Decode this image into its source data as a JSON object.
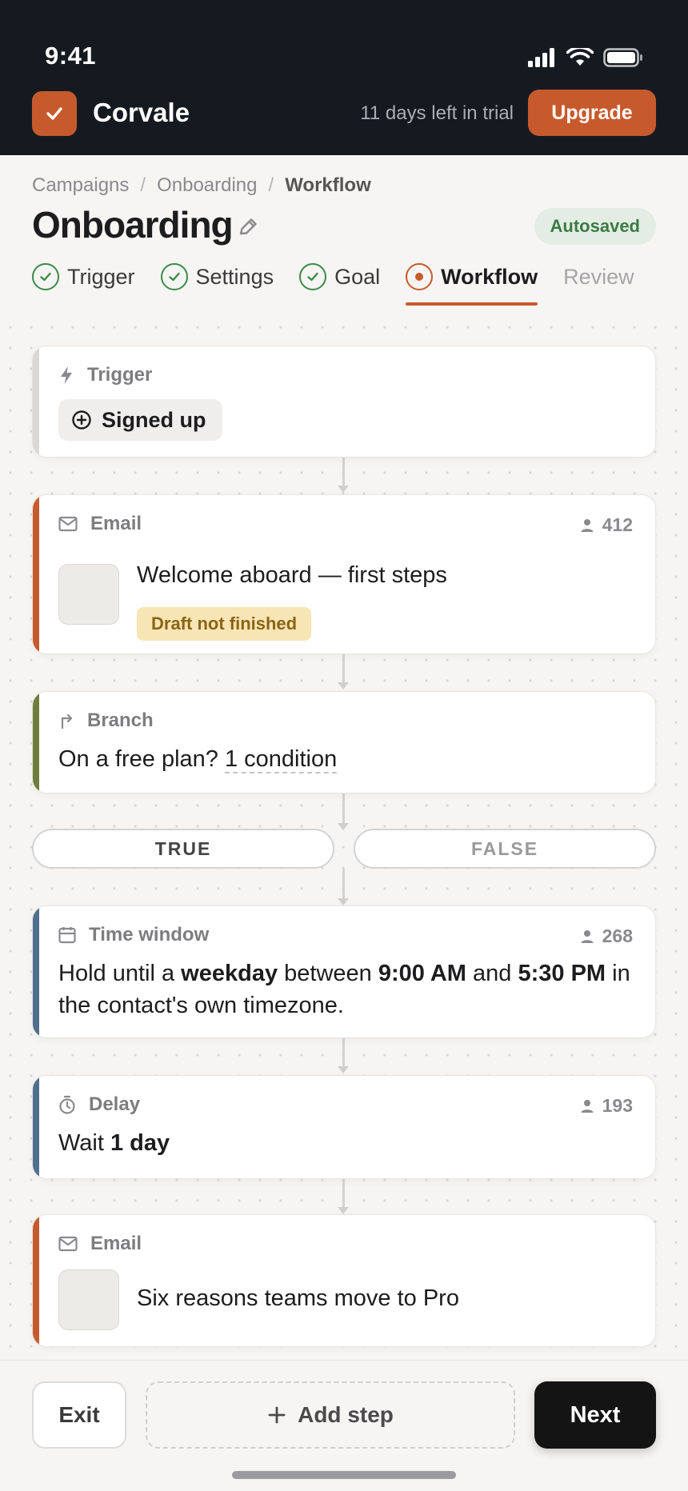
{
  "status_bar": {
    "time": "9:41"
  },
  "app": {
    "name": "Corvale",
    "trial_text": "11 days left in trial",
    "upgrade_label": "Upgrade"
  },
  "breadcrumb": [
    "Campaigns",
    "Onboarding",
    "Workflow"
  ],
  "page": {
    "title": "Onboarding",
    "autosave_status": "Autosaved"
  },
  "tabs": [
    {
      "label": "Trigger",
      "state": "done"
    },
    {
      "label": "Settings",
      "state": "done"
    },
    {
      "label": "Goal",
      "state": "done"
    },
    {
      "label": "Workflow",
      "state": "active"
    },
    {
      "label": "Review",
      "state": "pending"
    }
  ],
  "steps": {
    "trigger": {
      "type": "Trigger",
      "pill": "Signed up"
    },
    "email1": {
      "type": "Email",
      "count": "412",
      "subject": "Welcome aboard — first steps",
      "badge": "Draft not finished",
      "accent": "#c75a2c"
    },
    "branch": {
      "type": "Branch",
      "question": "On a free plan?",
      "condition": "1 condition",
      "accent": "#6f7d3c"
    },
    "branches": {
      "true_label": "TRUE",
      "false_label": "FALSE"
    },
    "time_window": {
      "type": "Time window",
      "count": "268",
      "accent": "#4f6f8f",
      "t1": "Hold until a ",
      "day": "weekday",
      "t2": " between ",
      "start": "9:00 AM",
      "t3": " and ",
      "end": "5:30 PM",
      "t4": " in the contact's own timezone."
    },
    "delay": {
      "type": "Delay",
      "count": "193",
      "prefix": "Wait ",
      "duration": "1 day",
      "accent": "#4f6f8f"
    },
    "email2": {
      "type": "Email",
      "subject": "Six reasons teams move to Pro",
      "accent": "#c75a2c"
    }
  },
  "footer": {
    "exit_label": "Exit",
    "add_step_label": "Add step",
    "next_label": "Next"
  }
}
